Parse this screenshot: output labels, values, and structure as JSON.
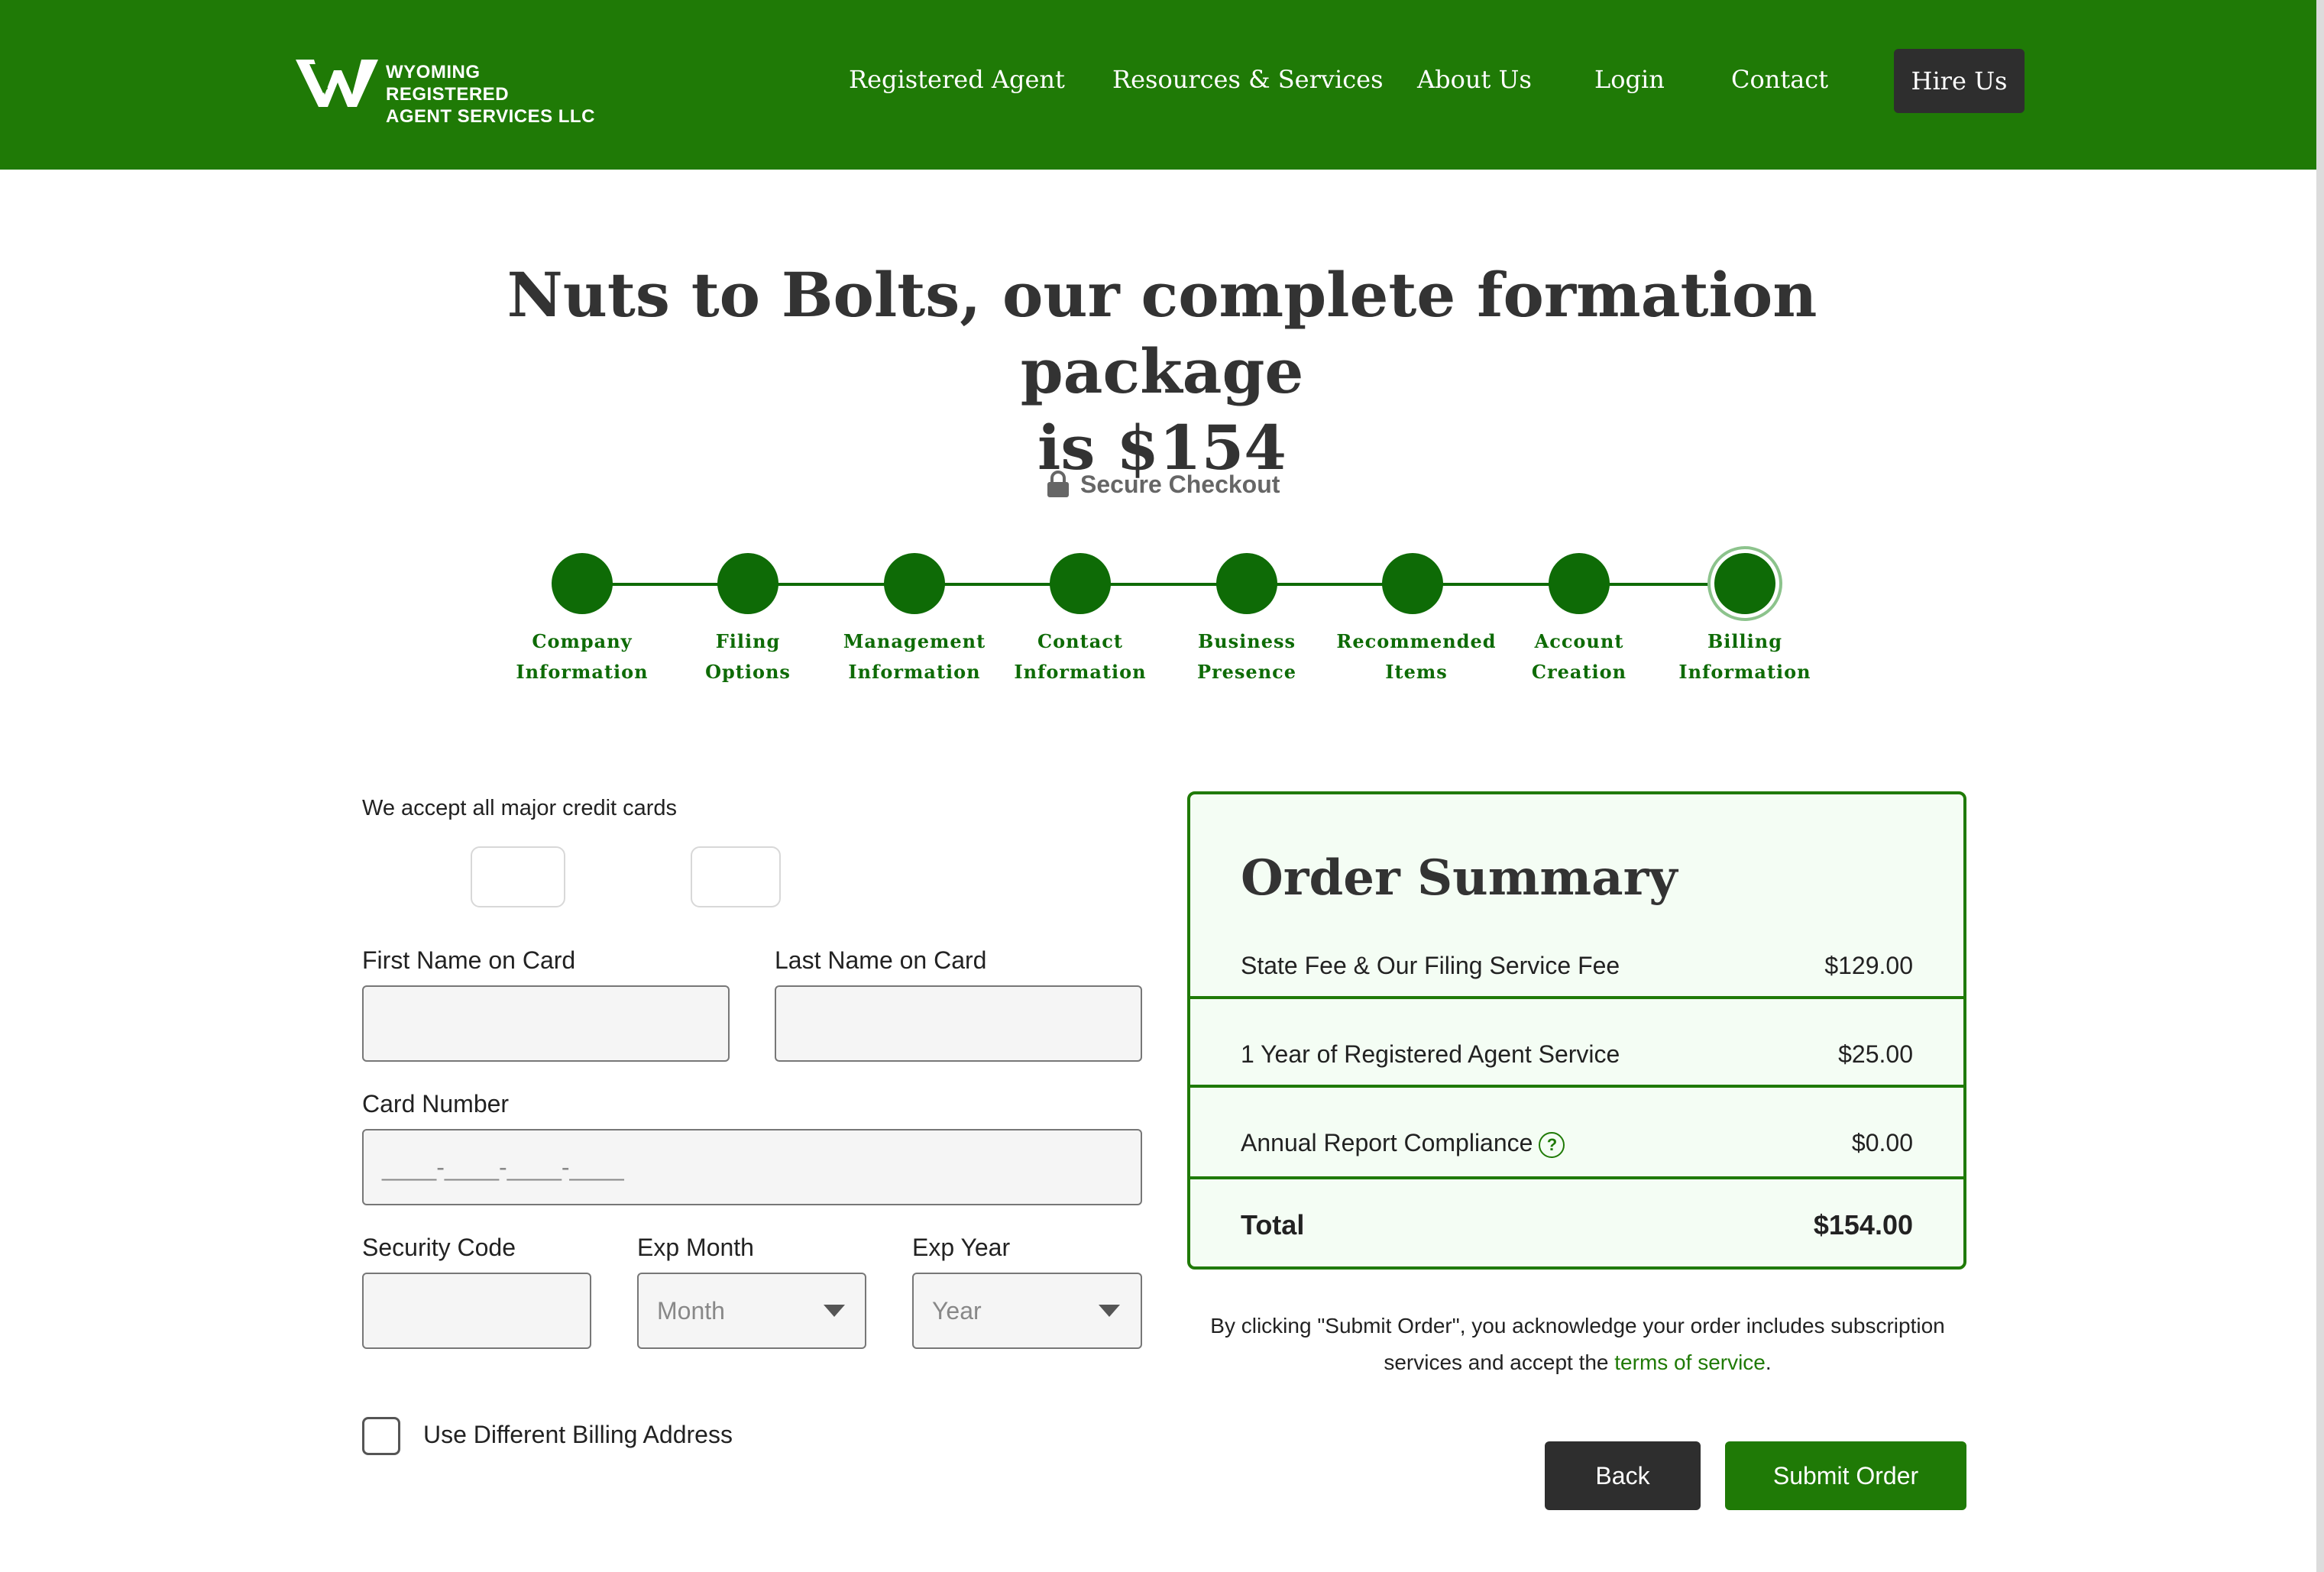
{
  "header": {
    "logo_line1": "WYOMING REGISTERED",
    "logo_line2": "AGENT SERVICES LLC",
    "nav": [
      "Registered Agent",
      "Resources & Services",
      "About Us",
      "Login",
      "Contact"
    ],
    "cta": "Hire Us"
  },
  "page": {
    "title_line1": "Nuts to Bolts, our complete formation package",
    "title_line2": "is $154",
    "secure_label": "Secure Checkout"
  },
  "steps": [
    {
      "line1": "Company",
      "line2": "Information"
    },
    {
      "line1": "Filing",
      "line2": "Options"
    },
    {
      "line1": "Management",
      "line2": "Information"
    },
    {
      "line1": "Contact",
      "line2": "Information"
    },
    {
      "line1": "Business",
      "line2": "Presence"
    },
    {
      "line1": "Recommended",
      "line2": "Items"
    },
    {
      "line1": "Account",
      "line2": "Creation"
    },
    {
      "line1": "Billing",
      "line2": "Information"
    }
  ],
  "active_step": "Billing Information",
  "form": {
    "cards_note": "We accept all major credit cards",
    "first_name_label": "First Name on Card",
    "last_name_label": "Last Name on Card",
    "card_number_label": "Card Number",
    "card_number_placeholder": "____-____-____-____",
    "security_code_label": "Security Code",
    "exp_month_label": "Exp Month",
    "exp_month_value": "Month",
    "exp_year_label": "Exp Year",
    "exp_year_value": "Year",
    "billing_checkbox_label": "Use Different Billing Address"
  },
  "summary": {
    "title": "Order Summary",
    "rows": [
      {
        "label": "State Fee & Our Filing Service Fee",
        "value": "$129.00"
      },
      {
        "label": "1 Year of Registered Agent Service",
        "value": "$25.00"
      },
      {
        "label": "Annual Report Compliance",
        "value": "$0.00"
      }
    ],
    "total_label": "Total",
    "total_value": "$154.00"
  },
  "disclaimer": {
    "line1": "By clicking \"Submit Order\", you acknowledge your order includes subscription",
    "line2_prefix": "services and accept the ",
    "link": "terms of service",
    "line2_suffix": "."
  },
  "buttons": {
    "back": "Back",
    "submit": "Submit Order"
  },
  "colors": {
    "brand_green": "#1f7a06",
    "step_green": "#0e6b06",
    "dark_button": "#2e2e2e"
  }
}
